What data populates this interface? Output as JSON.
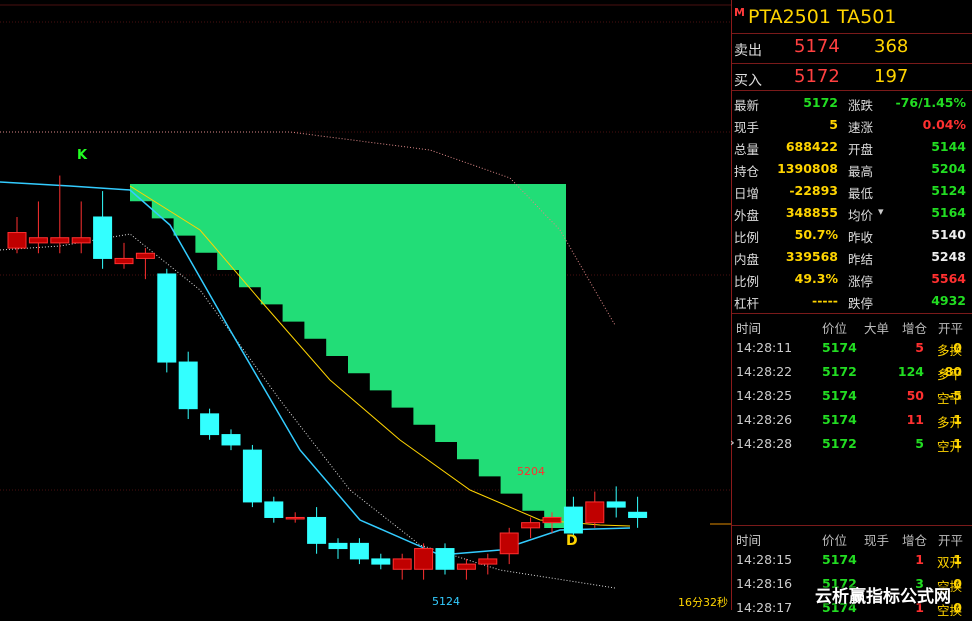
{
  "chart": {
    "k_label": "K",
    "d_label": "D",
    "high_label": "5204",
    "low_label": "5124",
    "timer": "16分32秒",
    "candles": [
      {
        "o": 5190,
        "h": 5193,
        "l": 5186,
        "c": 5187,
        "color": "red"
      },
      {
        "o": 5189,
        "h": 5196,
        "l": 5186,
        "c": 5188,
        "color": "red"
      },
      {
        "o": 5189,
        "h": 5201,
        "l": 5186,
        "c": 5188,
        "color": "red"
      },
      {
        "o": 5189,
        "h": 5196,
        "l": 5186,
        "c": 5188,
        "color": "red"
      },
      {
        "o": 5193,
        "h": 5198,
        "l": 5183,
        "c": 5185,
        "color": "cyan"
      },
      {
        "o": 5185,
        "h": 5188,
        "l": 5183,
        "c": 5184,
        "color": "red"
      },
      {
        "o": 5185,
        "h": 5187,
        "l": 5181,
        "c": 5186,
        "color": "red"
      },
      {
        "o": 5182,
        "h": 5183,
        "l": 5163,
        "c": 5165,
        "color": "cyan"
      },
      {
        "o": 5165,
        "h": 5167,
        "l": 5154,
        "c": 5156,
        "color": "cyan"
      },
      {
        "o": 5155,
        "h": 5156,
        "l": 5150,
        "c": 5151,
        "color": "cyan"
      },
      {
        "o": 5151,
        "h": 5152,
        "l": 5148,
        "c": 5149,
        "color": "cyan"
      },
      {
        "o": 5148,
        "h": 5149,
        "l": 5137,
        "c": 5138,
        "color": "cyan"
      },
      {
        "o": 5138,
        "h": 5139,
        "l": 5134,
        "c": 5135,
        "color": "cyan"
      },
      {
        "o": 5135,
        "h": 5136,
        "l": 5134,
        "c": 5135,
        "color": "red"
      },
      {
        "o": 5135,
        "h": 5137,
        "l": 5128,
        "c": 5130,
        "color": "cyan"
      },
      {
        "o": 5130,
        "h": 5131,
        "l": 5127,
        "c": 5129,
        "color": "cyan"
      },
      {
        "o": 5130,
        "h": 5131,
        "l": 5126,
        "c": 5127,
        "color": "cyan"
      },
      {
        "o": 5127,
        "h": 5128,
        "l": 5125,
        "c": 5126,
        "color": "cyan"
      },
      {
        "o": 5125,
        "h": 5128,
        "l": 5123,
        "c": 5127,
        "color": "red"
      },
      {
        "o": 5125,
        "h": 5130,
        "l": 5123,
        "c": 5129,
        "color": "red"
      },
      {
        "o": 5129,
        "h": 5130,
        "l": 5124,
        "c": 5125,
        "color": "cyan"
      },
      {
        "o": 5125,
        "h": 5127,
        "l": 5123,
        "c": 5126,
        "color": "red"
      },
      {
        "o": 5126,
        "h": 5128,
        "l": 5124,
        "c": 5127,
        "color": "red"
      },
      {
        "o": 5128,
        "h": 5133,
        "l": 5126,
        "c": 5132,
        "color": "red"
      },
      {
        "o": 5133,
        "h": 5135,
        "l": 5131,
        "c": 5134,
        "color": "red"
      },
      {
        "o": 5134,
        "h": 5136,
        "l": 5132,
        "c": 5135,
        "color": "red"
      },
      {
        "o": 5137,
        "h": 5139,
        "l": 5131,
        "c": 5132,
        "color": "cyan"
      },
      {
        "o": 5134,
        "h": 5140,
        "l": 5133,
        "c": 5138,
        "color": "red"
      },
      {
        "o": 5138,
        "h": 5141,
        "l": 5135,
        "c": 5137,
        "color": "cyan"
      },
      {
        "o": 5135,
        "h": 5139,
        "l": 5133,
        "c": 5136,
        "color": "cyan"
      }
    ]
  },
  "panel": {
    "marker": "M",
    "title": "PTA2501  TA501",
    "sell_label": "卖出",
    "sell_price": "5174",
    "sell_vol": "368",
    "buy_label": "买入",
    "buy_price": "5172",
    "buy_vol": "197",
    "quotes": [
      {
        "l1": "最新",
        "v1": "5172",
        "c1": "green",
        "l2": "涨跌",
        "v2": "-76/1.45%",
        "c2": "green"
      },
      {
        "l1": "现手",
        "v1": "5",
        "c1": "yellow",
        "l2": "速涨",
        "v2": "0.04%",
        "c2": "red"
      },
      {
        "l1": "总量",
        "v1": "688422",
        "c1": "yellow",
        "l2": "开盘",
        "v2": "5144",
        "c2": "green"
      },
      {
        "l1": "持仓",
        "v1": "1390808",
        "c1": "yellow",
        "l2": "最高",
        "v2": "5204",
        "c2": "green"
      },
      {
        "l1": "日增",
        "v1": "-22893",
        "c1": "yellow",
        "l2": "最低",
        "v2": "5124",
        "c2": "green"
      },
      {
        "l1": "外盘",
        "v1": "348855",
        "c1": "yellow",
        "l2": "均价",
        "v2": "5164",
        "c2": "green"
      },
      {
        "l1": "比例",
        "v1": "50.7%",
        "c1": "yellow",
        "l2": "昨收",
        "v2": "5140",
        "c2": "white"
      },
      {
        "l1": "内盘",
        "v1": "339568",
        "c1": "yellow",
        "l2": "昨结",
        "v2": "5248",
        "c2": "white"
      },
      {
        "l1": "比例",
        "v1": "49.3%",
        "c1": "yellow",
        "l2": "涨停",
        "v2": "5564",
        "c2": "red"
      },
      {
        "l1": "杠杆",
        "v1": "-----",
        "c1": "yellow",
        "l2": "跌停",
        "v2": "4932",
        "c2": "green"
      }
    ],
    "ticks_header": {
      "time": "时间",
      "price": "价位",
      "vol": "大单",
      "oi": "增仓",
      "type": "开平"
    },
    "ticks": [
      {
        "time": "14:28:11",
        "price": "5174",
        "vol": "5",
        "vol_c": "red",
        "oi": "0",
        "oi_c": "yellow",
        "type": "多换",
        "type_c": "yellow"
      },
      {
        "time": "14:28:22",
        "price": "5172",
        "vol": "124",
        "vol_c": "green",
        "oi": "-80",
        "oi_c": "yellow",
        "type": "多平",
        "type_c": "yellow"
      },
      {
        "time": "14:28:25",
        "price": "5174",
        "vol": "50",
        "vol_c": "red",
        "oi": "-5",
        "oi_c": "yellow",
        "type": "空平",
        "type_c": "yellow"
      },
      {
        "time": "14:28:26",
        "price": "5174",
        "vol": "11",
        "vol_c": "red",
        "oi": "1",
        "oi_c": "yellow",
        "type": "多开",
        "type_c": "yellow"
      },
      {
        "time": "14:28:28",
        "price": "5172",
        "vol": "5",
        "vol_c": "green",
        "oi": "1",
        "oi_c": "yellow",
        "type": "空开",
        "type_c": "yellow"
      }
    ],
    "ticks_header2": {
      "time": "时间",
      "price": "价位",
      "vol": "现手",
      "oi": "增仓",
      "type": "开平"
    },
    "ticks2": [
      {
        "time": "14:28:15",
        "price": "5174",
        "vol": "1",
        "vol_c": "red",
        "oi": "1",
        "oi_c": "yellow",
        "type": "双开",
        "type_c": "yellow"
      },
      {
        "time": "14:28:16",
        "price": "5172",
        "vol": "3",
        "vol_c": "green",
        "oi": "0",
        "oi_c": "yellow",
        "type": "空换",
        "type_c": "yellow"
      },
      {
        "time": "14:28:17",
        "price": "5174",
        "vol": "1",
        "vol_c": "red",
        "oi": "0",
        "oi_c": "yellow",
        "type": "空换",
        "type_c": "yellow"
      }
    ],
    "watermark": "云析赢指标公式网"
  }
}
